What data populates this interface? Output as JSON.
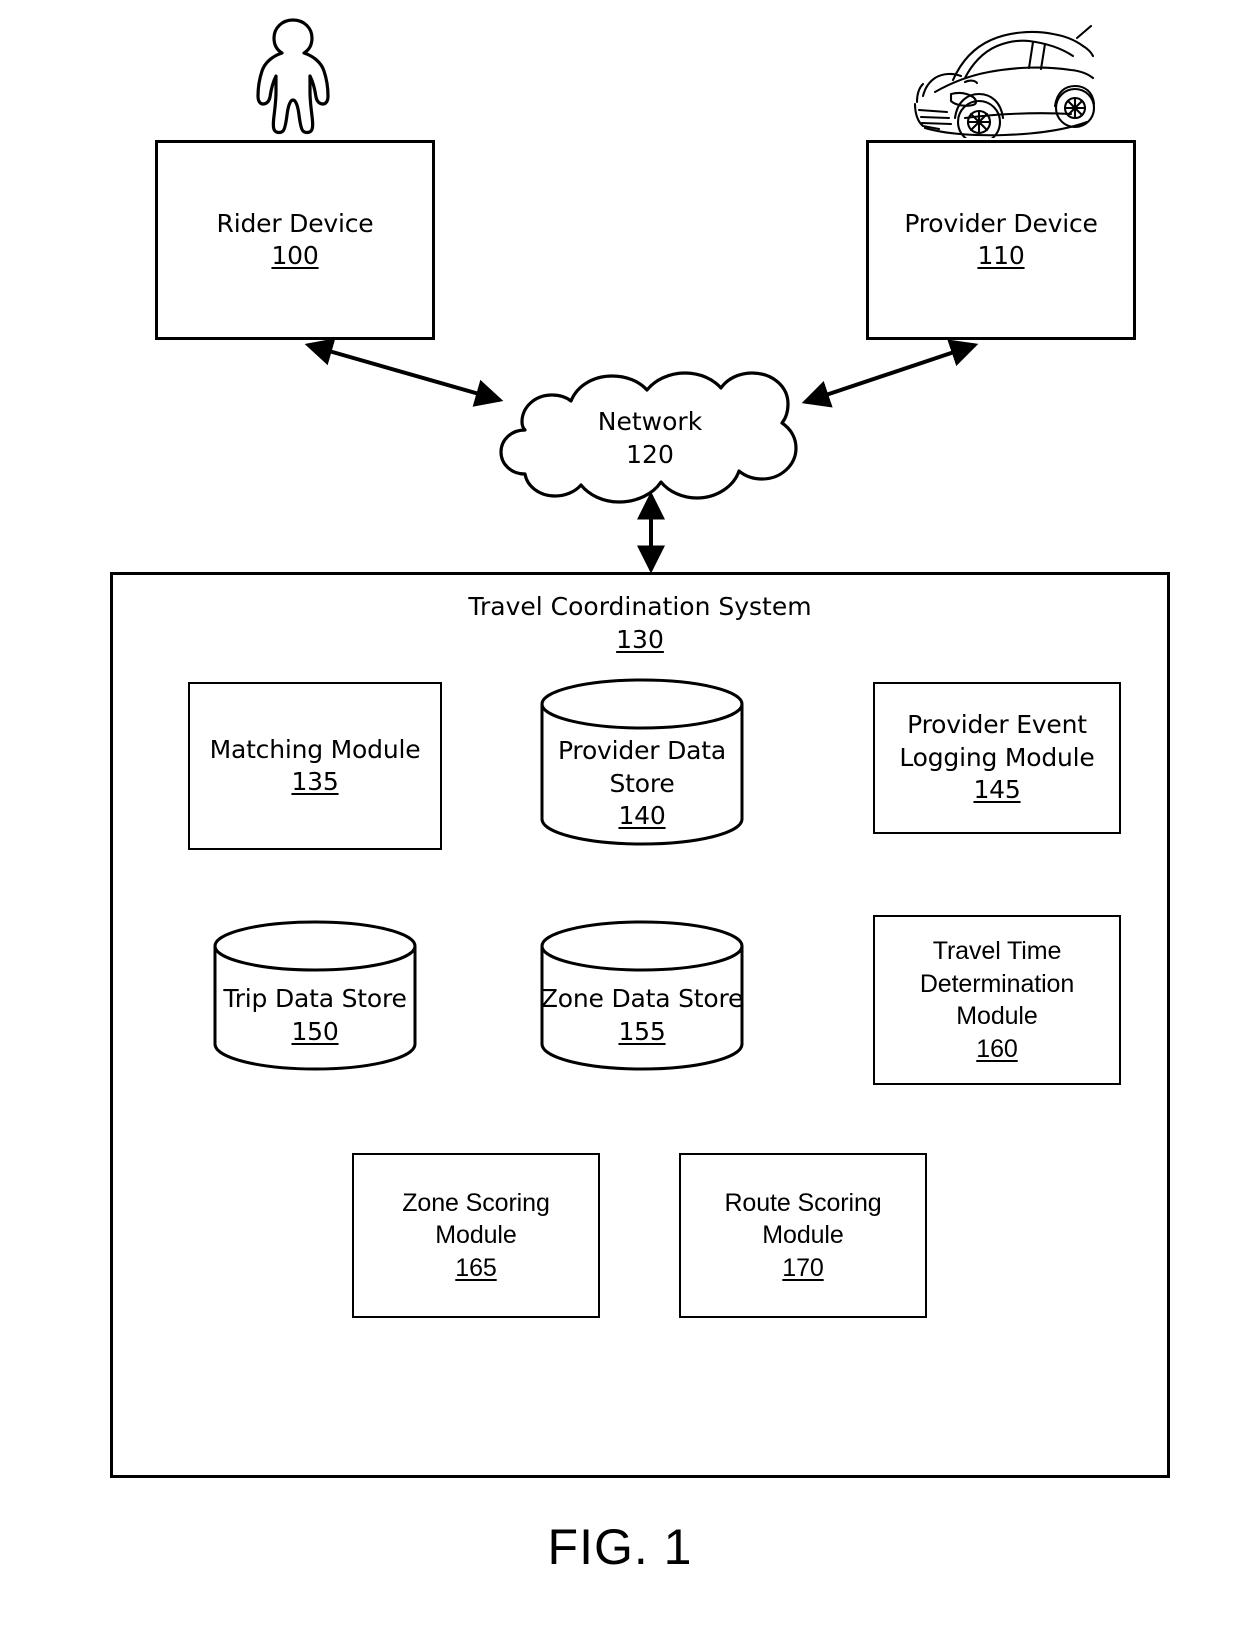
{
  "figure": {
    "caption": "FIG. 1"
  },
  "icons": {
    "rider": "person-icon",
    "provider": "car-icon"
  },
  "nodes": {
    "rider_device": {
      "label": "Rider Device",
      "ref": "100"
    },
    "provider_device": {
      "label": "Provider Device",
      "ref": "110"
    },
    "network": {
      "label": "Network",
      "ref": "120"
    },
    "system": {
      "label": "Travel Coordination System",
      "ref": "130"
    }
  },
  "modules": {
    "matching": {
      "line1": "Matching Module",
      "ref": "135"
    },
    "provider_data_store": {
      "line1": "Provider Data",
      "line2": "Store",
      "ref": "140"
    },
    "provider_event_logging": {
      "line1": "Provider Event",
      "line2": "Logging Module",
      "ref": "145"
    },
    "trip_data_store": {
      "line1": "Trip Data Store",
      "ref": "150"
    },
    "zone_data_store": {
      "line1": "Zone Data Store",
      "ref": "155"
    },
    "travel_time": {
      "line1": "Travel Time",
      "line2": "Determination",
      "line3": "Module",
      "ref": "160"
    },
    "zone_scoring": {
      "line1": "Zone Scoring",
      "line2": "Module",
      "ref": "165"
    },
    "route_scoring": {
      "line1": "Route Scoring",
      "line2": "Module",
      "ref": "170"
    }
  },
  "connectors": [
    {
      "name": "rider-to-network",
      "type": "double-arrow"
    },
    {
      "name": "provider-to-network",
      "type": "double-arrow"
    },
    {
      "name": "network-to-system",
      "type": "double-arrow"
    }
  ],
  "colors": {
    "stroke": "#000000",
    "background": "#ffffff"
  }
}
